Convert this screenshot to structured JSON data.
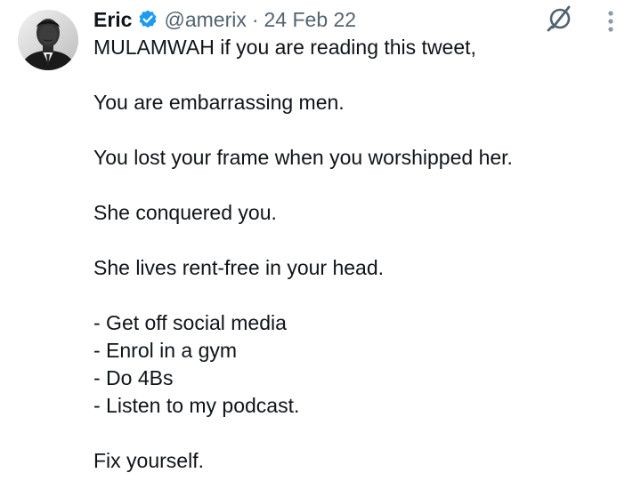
{
  "tweet": {
    "author": {
      "display_name": "Eric",
      "handle": "@amerix",
      "verified": true,
      "avatar": "profile-photo"
    },
    "separator": "·",
    "date": "24 Feb 22",
    "icons": {
      "grok": "grok-icon",
      "more": "more-vertical-icon",
      "verified": "verified-badge-icon"
    },
    "colors": {
      "verified_blue": "#1d9bf0",
      "text": "#0f1419",
      "secondary": "#536471"
    },
    "lines": [
      {
        "mention": "MULAMWAH",
        "text": " if you are reading this tweet,"
      },
      {
        "text": ""
      },
      {
        "text": "You are embarrassing men."
      },
      {
        "text": ""
      },
      {
        "text": "You lost your frame when you worshipped her."
      },
      {
        "text": ""
      },
      {
        "text": "She conquered you."
      },
      {
        "text": ""
      },
      {
        "text": "She lives rent-free in your head."
      },
      {
        "text": ""
      },
      {
        "text": "- Get off social media"
      },
      {
        "text": "- Enrol in a gym"
      },
      {
        "text": "- Do 4Bs"
      },
      {
        "text": "- Listen to my podcast."
      },
      {
        "text": ""
      },
      {
        "text": "Fix yourself."
      }
    ]
  }
}
